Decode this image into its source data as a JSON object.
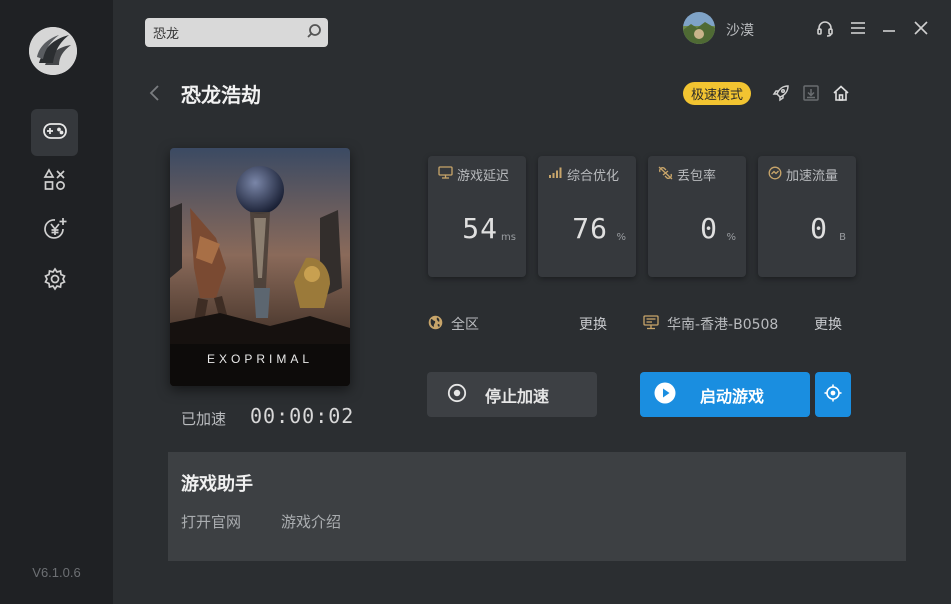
{
  "app": {
    "version": "V6.1.0.6"
  },
  "sidebar": {
    "items": [
      {
        "icon": "gamepad-icon",
        "active": true
      },
      {
        "icon": "apps-icon",
        "active": false
      },
      {
        "icon": "yen-plus-icon",
        "active": false
      },
      {
        "icon": "gear-icon",
        "active": false
      }
    ]
  },
  "search": {
    "value": "恐龙"
  },
  "user": {
    "name": "沙漠"
  },
  "header": {
    "title": "恐龙浩劫",
    "speed_mode_label": "极速模式"
  },
  "cover": {
    "logo_text": "EXOPRIMAL"
  },
  "accel": {
    "label": "已加速",
    "time": "00:00:02"
  },
  "stats": [
    {
      "label": "游戏延迟",
      "value": "54",
      "unit": "ms",
      "icon": "latency-icon"
    },
    {
      "label": "综合优化",
      "value": "76",
      "unit": "%",
      "icon": "signal-bars-icon"
    },
    {
      "label": "丢包率",
      "value": "0",
      "unit": "%",
      "icon": "packet-loss-icon"
    },
    {
      "label": "加速流量",
      "value": "0",
      "unit": "B",
      "icon": "traffic-icon"
    }
  ],
  "region": {
    "area": "全区",
    "area_change": "更换",
    "server": "华南-香港-B0508",
    "server_change": "更换"
  },
  "actions": {
    "stop_label": "停止加速",
    "start_label": "启动游戏"
  },
  "assistant": {
    "title": "游戏助手",
    "links": [
      "打开官网",
      "游戏介绍"
    ]
  },
  "colors": {
    "accent": "#1a8ee0",
    "badge": "#f2c431",
    "sidebar_bg": "#1f2124",
    "main_bg": "#2b2e31"
  }
}
